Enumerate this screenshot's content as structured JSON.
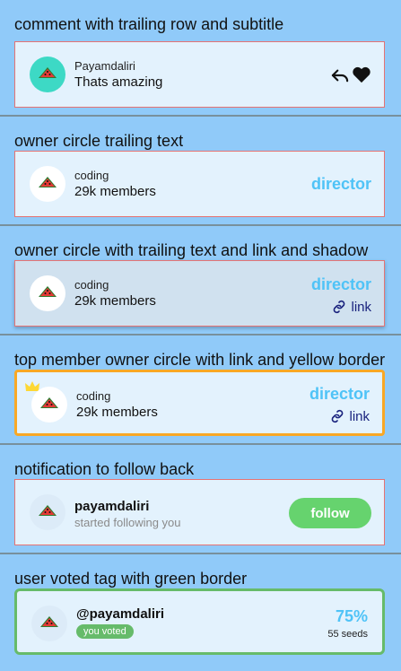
{
  "sections": [
    {
      "title": "comment with trailing row and subtitle",
      "username": "Payamdaliri",
      "comment": "Thats amazing",
      "icons": [
        "watermelon-icon",
        "reply-icon",
        "heart-icon"
      ]
    },
    {
      "title": "owner circle trailing text",
      "group": "coding",
      "members": "29k members",
      "role": "director"
    },
    {
      "title": "owner circle with trailing text and link and shadow",
      "group": "coding",
      "members": "29k members",
      "role": "director",
      "link": "link"
    },
    {
      "title": "top member owner circle with link and yellow border",
      "group": "coding",
      "members": "29k members",
      "role": "director",
      "link": "link",
      "border_color": "#f9a825"
    },
    {
      "title": "notification to follow back",
      "username": "payamdaliri",
      "subtitle": "started following you",
      "button": "follow"
    },
    {
      "title": "user voted tag with green border",
      "username": "@payamdaliri",
      "tag": "you voted",
      "percent": "75%",
      "seeds": "55 seeds",
      "border_color": "#66bb6a"
    }
  ],
  "colors": {
    "background": "#90caf9",
    "card": "#e3f2fd",
    "accent": "#4fc3f7",
    "follow": "#66d36e"
  }
}
